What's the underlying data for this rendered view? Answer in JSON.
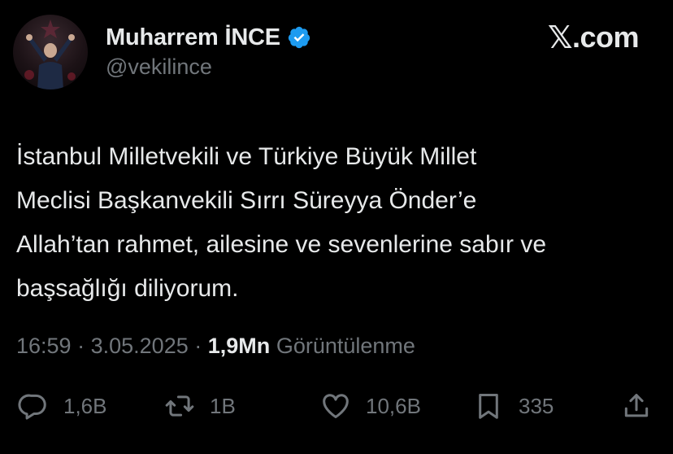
{
  "author": {
    "display_name": "Muharrem İNCE",
    "handle": "@vekilince",
    "verified": true
  },
  "brand": {
    "x_glyph": "𝕏",
    "suffix": ".com"
  },
  "tweet": {
    "lines": [
      "İstanbul Milletvekili ve Türkiye Büyük Millet",
      "Meclisi Başkanvekili Sırrı Süreyya Önder’e",
      "Allah’tan rahmet, ailesine ve sevenlerine sabır ve",
      "başsağlığı diliyorum."
    ]
  },
  "meta": {
    "time": "16:59",
    "separator": "·",
    "date": "3.05.2025",
    "views_count": "1,9Mn",
    "views_label": "Görüntülenme"
  },
  "actions": {
    "replies": "1,6B",
    "reposts": "1B",
    "likes": "10,6B",
    "bookmarks": "335"
  },
  "icons": {
    "verified": "verified-badge-icon",
    "reply": "reply-icon",
    "repost": "repost-icon",
    "like": "heart-icon",
    "bookmark": "bookmark-icon",
    "share": "share-icon"
  },
  "colors": {
    "background": "#000000",
    "text": "#e7e9ea",
    "secondary": "#71767b",
    "verified": "#1d9bf0"
  }
}
